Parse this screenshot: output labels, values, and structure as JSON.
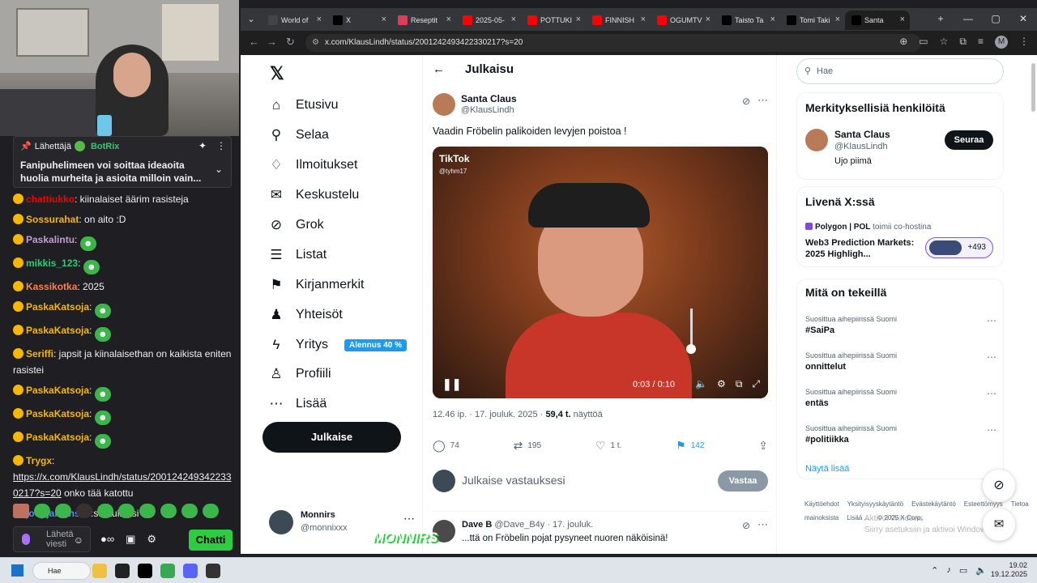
{
  "stream": {
    "pinned": {
      "sender_label": "Lähettäjä",
      "sender_name": "BotRix",
      "message": "Fanipuhelimeen voi soittaa ideaoita huolia murheita ja asioita milloin vain..."
    },
    "chat": [
      {
        "user": "chattiukko",
        "color": "#eb0400",
        "text": ": kiinalaiset äärim rasisteja"
      },
      {
        "user": "Sossurahat",
        "color": "#f5b700",
        "text": ": on aito :D"
      },
      {
        "user": "Paskalintu",
        "color": "#c39bd3",
        "text": ":"
      },
      {
        "user": "mikkis_123",
        "color": "#2ecc71",
        "text": ":"
      },
      {
        "user": "Kassikotka",
        "color": "#ff7f50",
        "text": ": 2025"
      },
      {
        "user": "PaskaKatsoja",
        "color": "#f5b700",
        "text": ":"
      },
      {
        "user": "PaskaKatsoja",
        "color": "#f5b700",
        "text": ":"
      },
      {
        "user": "Seriffi",
        "color": "#f5b700",
        "text": ": japsit ja kiinalaisethan on kaikista eniten rasistei"
      },
      {
        "user": "PaskaKatsoja",
        "color": "#f5b700",
        "text": ":"
      },
      {
        "user": "PaskaKatsoja",
        "color": "#f5b700",
        "text": ":"
      },
      {
        "user": "PaskaKatsoja",
        "color": "#f5b700",
        "text": ":"
      },
      {
        "user": "Trygx",
        "color": "#f5b700",
        "text": ":",
        "link": "https://x.com/KlausLindh/status/2001242493422330217?s=20",
        "after": " onko tää katottu"
      },
      {
        "user": "joopjanains1",
        "color": "#5b8def",
        "text": ":",
        "after": " :sta tuli riisi"
      }
    ],
    "input_placeholder": "Lähetä viesti",
    "chat_button": "Chatti"
  },
  "browser": {
    "tabs": [
      {
        "label": "World of",
        "color": "#444"
      },
      {
        "label": "X",
        "color": "#000"
      },
      {
        "label": "Reseptit",
        "color": "#e2395d"
      },
      {
        "label": "2025-05-",
        "color": "#ff0000"
      },
      {
        "label": "POTTUKI",
        "color": "#ff0000"
      },
      {
        "label": "FINNISH",
        "color": "#ff0000"
      },
      {
        "label": "OGUMTV",
        "color": "#ff0000"
      },
      {
        "label": "Taisto Ta",
        "color": "#000"
      },
      {
        "label": "Tomi Taki",
        "color": "#000"
      },
      {
        "label": "Santa",
        "color": "#000"
      }
    ],
    "url": "x.com/KlausLindh/status/2001242493422330217?s=20",
    "avatar_letter": "M"
  },
  "x": {
    "nav": [
      {
        "label": "Etusivu",
        "icon": "⌂"
      },
      {
        "label": "Selaa",
        "icon": "⚲"
      },
      {
        "label": "Ilmoitukset",
        "icon": "♢"
      },
      {
        "label": "Keskustelu",
        "icon": "✉"
      },
      {
        "label": "Grok",
        "icon": "⊘"
      },
      {
        "label": "Listat",
        "icon": "☰"
      },
      {
        "label": "Kirjanmerkit",
        "icon": "⚑"
      },
      {
        "label": "Yhteisöt",
        "icon": "♟"
      },
      {
        "label": "Yritys",
        "icon": "ϟ"
      },
      {
        "label": "Profiili",
        "icon": "♙"
      },
      {
        "label": "Lisää",
        "icon": "⋯"
      }
    ],
    "promo": "Alennus 40 %",
    "post_button": "Julkaise",
    "account": {
      "name": "Monnirs",
      "handle": "@monnixxx"
    },
    "header_title": "Julkaisu",
    "post": {
      "author": "Santa Claus",
      "handle": "@KlausLindh",
      "text": "Vaadin Fröbelin palikoiden levyjen poistoa !",
      "video_brand": "TikTok",
      "video_handle": "@tyhm17",
      "video_time": "0:03 / 0:10",
      "time": "12.46 ip. · 17. jouluk. 2025 · ",
      "views": "59,4 t.",
      "views_label": " näyttöä",
      "replies": "74",
      "reposts": "195",
      "likes": "1 t.",
      "bookmarks": "142"
    },
    "reply_placeholder": "Julkaise vastauksesi",
    "reply_button": "Vastaa",
    "reply_post": {
      "author": "Dave B",
      "handle": "@Dave_B4y",
      "date": " · 17. jouluk.",
      "text": "...ttä on Fröbelin pojat pysyneet nuoren näköisinä!"
    },
    "search_placeholder": "Hae",
    "relevant": {
      "title": "Merkityksellisiä henkilöitä",
      "name": "Santa Claus",
      "handle": "@KlausLindh",
      "bio": "Ujo piimä",
      "follow": "Seuraa"
    },
    "live": {
      "title": "Livenä X:ssä",
      "host": "Polygon | POL",
      "host_suffix": " toimii co-hostina",
      "space_title": "Web3 Prediction Markets: 2025 Highligh...",
      "count": "+493"
    },
    "trends_title": "Mitä on tekeillä",
    "trends": [
      {
        "context": "Suosittua aihepiirissä Suomi",
        "name": "#SaiPa"
      },
      {
        "context": "Suosittua aihepiirissä Suomi",
        "name": "onnittelut"
      },
      {
        "context": "Suosittua aihepiirissä Suomi",
        "name": "entäs"
      },
      {
        "context": "Suosittua aihepiirissä Suomi",
        "name": "#politiikka"
      }
    ],
    "show_more": "Näytä lisää",
    "footer": [
      "Käyttöehdot",
      "Yksityisyyskäytäntö",
      "Evästekäytäntö",
      "Esteettömyys",
      "Tietoa mainoksista",
      "Lisää ...",
      "© 2025 X Corp."
    ],
    "activate_windows": "Aktivoi Windows",
    "activate_sub": "Siirry asetuksiin ja aktivoi Windows."
  },
  "overlay_logo": "MONNIRS",
  "taskbar": {
    "search": "Hae",
    "time": "19.02",
    "date": "19.12.2025"
  }
}
